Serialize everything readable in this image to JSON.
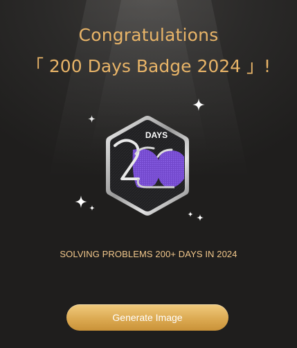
{
  "dialog": {
    "title_line1": "Congratulations",
    "title_line2": "「 200 Days Badge 2024 」!",
    "badge": {
      "days_label": "DAYS",
      "icon": "200-days-badge-icon"
    },
    "description": "SOLVING PROBLEMS 200+ DAYS IN 2024",
    "generate_button_label": "Generate Image"
  },
  "colors": {
    "title_gold": "#e8b468",
    "description_gold": "#f2c88c",
    "button_gold": "#dcaa52",
    "badge_purple": "#7b4ad6"
  }
}
